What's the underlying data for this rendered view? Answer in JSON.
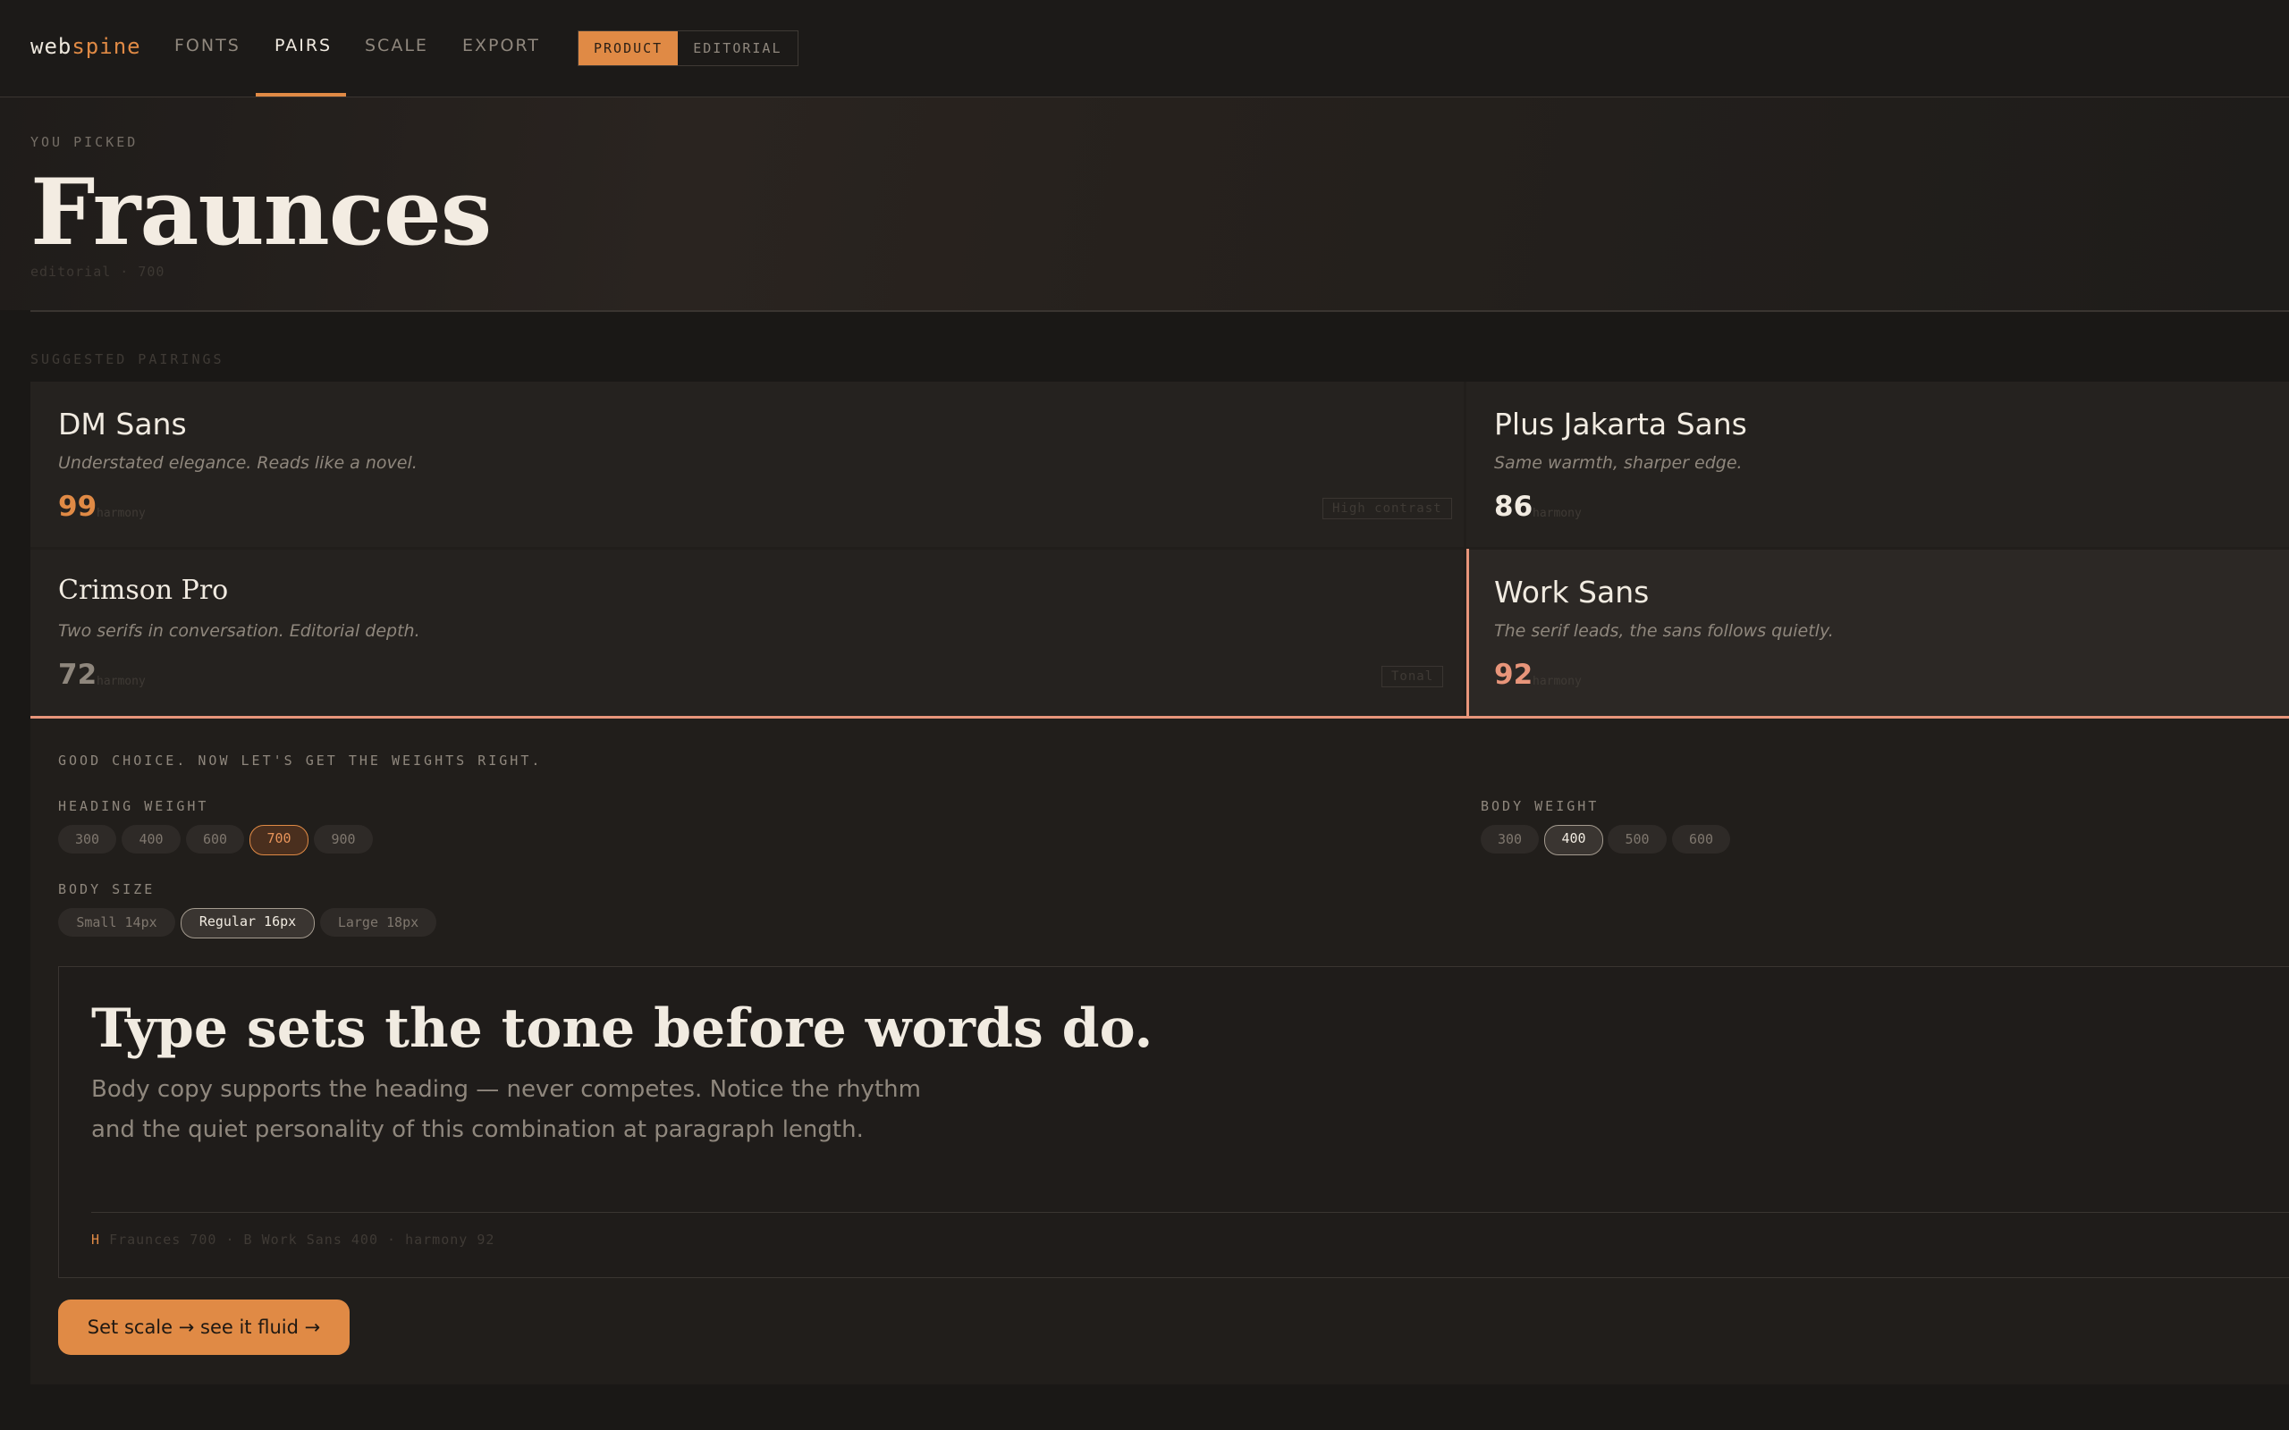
{
  "brand": {
    "part1": "web",
    "part2": "spine"
  },
  "nav": {
    "fonts": "FONTS",
    "pairs": "PAIRS",
    "scale": "SCALE",
    "export": "EXPORT"
  },
  "mode": {
    "product": "PRODUCT",
    "editorial": "EDITORIAL",
    "selected": "PRODUCT"
  },
  "hero": {
    "eyebrow": "YOU PICKED",
    "title": "Fraunces",
    "subtitle": "editorial · 700"
  },
  "pairings": {
    "label": "SUGGESTED PAIRINGS",
    "harmony_label": "harmony",
    "items": [
      {
        "name": "DM Sans",
        "desc": "Understated elegance. Reads like a novel.",
        "score": "99",
        "tag": "High contrast"
      },
      {
        "name": "Plus Jakarta Sans",
        "desc": "Same warmth, sharper edge.",
        "score": "86",
        "tag": ""
      },
      {
        "name": "Crimson Pro",
        "desc": "Two serifs in conversation. Editorial depth.",
        "score": "72",
        "tag": "Tonal"
      },
      {
        "name": "Work Sans",
        "desc": "The serif leads, the sans follows quietly.",
        "score": "92",
        "tag": ""
      }
    ],
    "selected": "Work Sans"
  },
  "weights": {
    "intro": "GOOD CHOICE. NOW LET'S GET THE WEIGHTS RIGHT.",
    "heading_label": "HEADING WEIGHT",
    "heading_options": [
      "300",
      "400",
      "600",
      "700",
      "900"
    ],
    "heading_selected": "700",
    "body_label": "BODY WEIGHT",
    "body_options": [
      "300",
      "400",
      "500",
      "600"
    ],
    "body_selected": "400",
    "size_label": "BODY SIZE",
    "size_options": [
      "Small 14px",
      "Regular 16px",
      "Large 18px"
    ],
    "size_selected": "Regular 16px"
  },
  "preview": {
    "heading": "Type sets the tone before words do.",
    "body": "Body copy supports the heading — never competes. Notice the rhythm and the quiet personality of this combination at paragraph length.",
    "meta_h": "H",
    "meta_rest": "Fraunces 700 · B Work Sans 400 · harmony 92"
  },
  "cta": {
    "label": "Set scale → see it fluid  →"
  },
  "colors": {
    "accent": "#e08a45",
    "pick": "#e8957a",
    "bg": "#1a1816"
  }
}
